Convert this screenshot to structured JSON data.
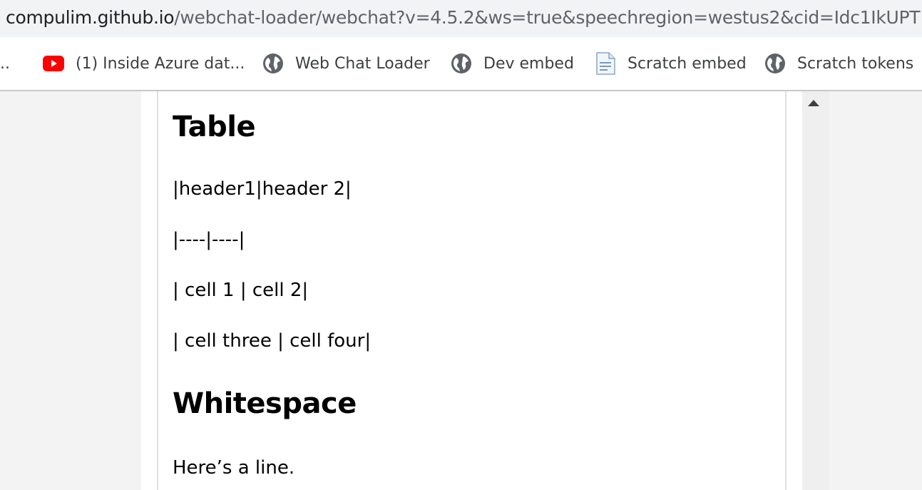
{
  "browser": {
    "url_host": "compulim.github.io",
    "url_rest": "/webchat-loader/webchat?v=4.5.2&ws=true&speechregion=westus2&cid=Idc1IkUPT"
  },
  "bookmarks": {
    "overflow": "..",
    "items": [
      {
        "label": "(1) Inside Azure dat...",
        "icon": "youtube-icon"
      },
      {
        "label": "Web Chat Loader",
        "icon": "globe-icon"
      },
      {
        "label": "Dev embed",
        "icon": "globe-icon"
      },
      {
        "label": "Scratch embed",
        "icon": "document-icon"
      },
      {
        "label": "Scratch tokens",
        "icon": "globe-icon"
      }
    ]
  },
  "message": {
    "heading_table": "Table",
    "lines": [
      "|header1|header 2|",
      "|----|----|",
      "| cell 1 | cell 2|",
      "| cell three | cell four|"
    ],
    "heading_whitespace": "Whitespace",
    "whitespace_line": "Here’s a line."
  },
  "colors": {
    "youtube_red": "#ff0000",
    "text": "#000000",
    "panel_border": "#e0e0e0"
  }
}
